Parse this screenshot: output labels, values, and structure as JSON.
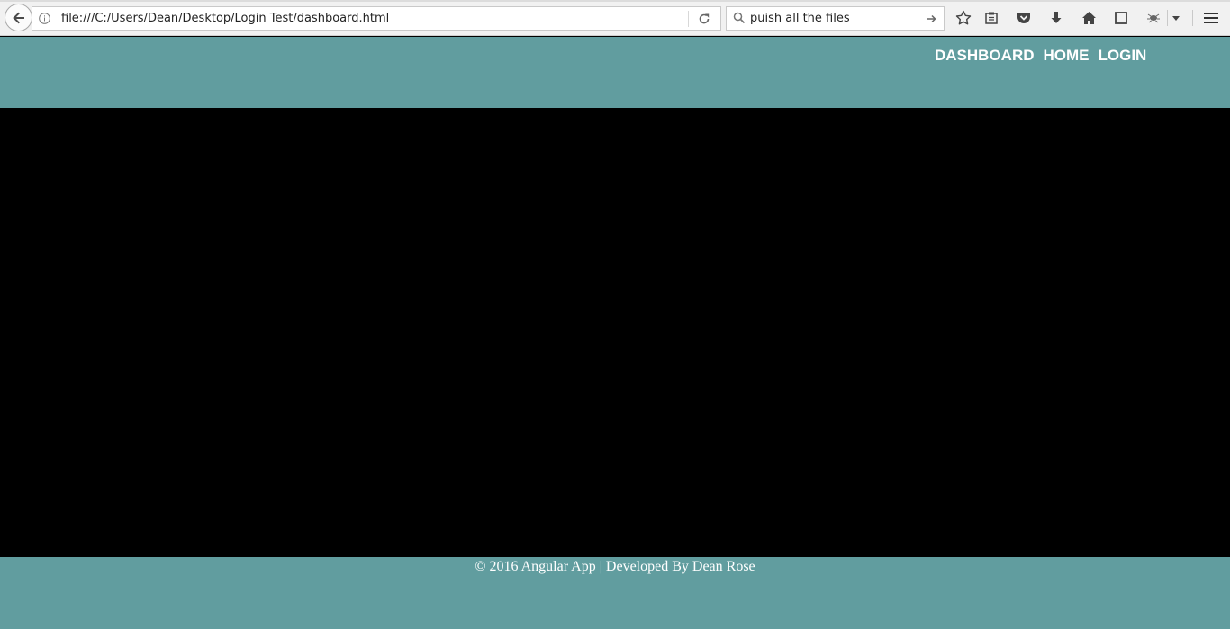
{
  "browser": {
    "url": "file:///C:/Users/Dean/Desktop/Login Test/dashboard.html",
    "search_value": "puish all the files"
  },
  "icons": {
    "back": "back-arrow-icon",
    "info": "info-icon",
    "reload": "reload-icon",
    "search": "search-icon",
    "search_go": "arrow-right-icon",
    "bookmark": "star-icon",
    "reading_list": "clipboard-icon",
    "pocket": "pocket-icon",
    "download": "download-arrow-icon",
    "home": "home-icon",
    "window": "window-icon",
    "extension": "bug-icon",
    "dropdown": "chevron-down-icon",
    "menu": "hamburger-menu-icon"
  },
  "nav": {
    "items": [
      {
        "label": "DASHBOARD"
      },
      {
        "label": "HOME"
      },
      {
        "label": "LOGIN"
      }
    ]
  },
  "footer": {
    "text": "© 2016 Angular App | Developed By Dean Rose"
  },
  "colors": {
    "header_bg": "#619d9f",
    "content_bg": "#000000",
    "nav_text": "#ffffff"
  }
}
